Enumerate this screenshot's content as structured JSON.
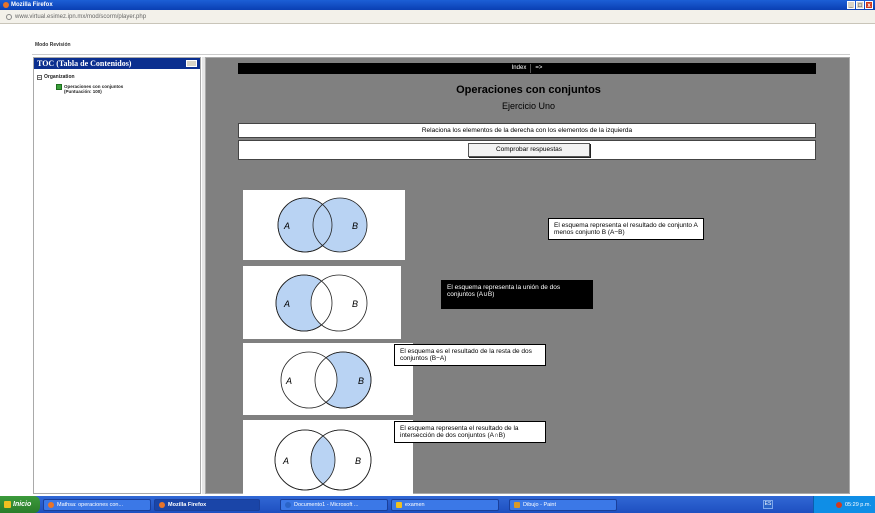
{
  "window": {
    "title": "Mozilla Firefox",
    "buttons": {
      "minimize": "_",
      "maximize": "□",
      "close": "x"
    }
  },
  "address": {
    "url": "www.virtual.esimez.ipn.mx/mod/scorm/player.php"
  },
  "page": {
    "mode_label": "Modo Revisión",
    "toc": {
      "header": "TOC (Tabla de Contenidos)",
      "organization": "Organization",
      "item": "Operaciones con conjuntos (Puntuación: 100)"
    },
    "nav": {
      "index": "Index",
      "next": "=>"
    },
    "title": "Operaciones con conjuntos",
    "subtitle": "Ejercicio Uno",
    "instruction": "Relaciona los elementos de la derecha con los elementos de la izquierda",
    "check_button": "Comprobar respuestas",
    "venn_labels": {
      "a": "A",
      "b": "B"
    },
    "descriptions": [
      "El esquema representa el resultado de conjunto A menos conjunto B (A−B)",
      "El esquema representa la unión de dos conjuntos (A∪B)",
      "El esquema es el resultado de la resta de dos conjuntos (B−A)",
      "El esquema representa el resultado de la intersección de dos conjuntos (A∩B)"
    ]
  },
  "taskbar": {
    "start": "Inicio",
    "tasks": [
      "Mathsa: operaciones con...",
      "Mozilla Firefox",
      "Documento1 - Microsoft ...",
      "examen",
      "Dibujo - Paint"
    ],
    "lang": "ES",
    "clock": "05:29 p.m."
  },
  "colors": {
    "venn_fill": "#b9d3f3",
    "toc_header": "#0b2f8f",
    "content_bg": "#808080"
  }
}
